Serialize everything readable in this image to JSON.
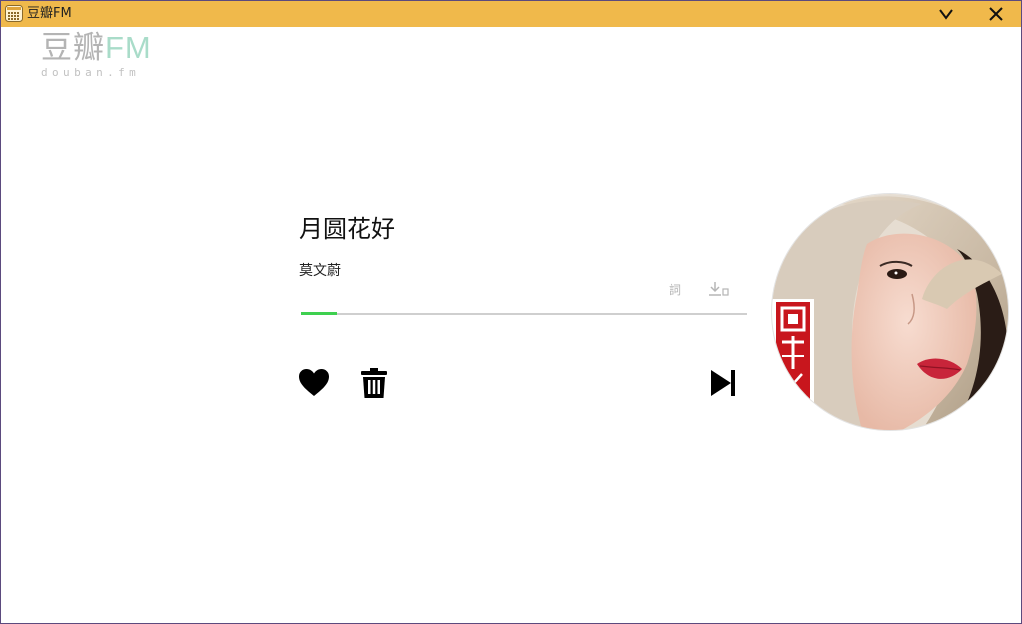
{
  "window": {
    "title": "豆瓣FM",
    "icon": "app-grid-icon",
    "minimize_icon": "chevron-down-icon",
    "close_icon": "close-icon",
    "titlebar_color": "#f0b94b"
  },
  "logo": {
    "main_cn": "豆瓣",
    "main_fm": "FM",
    "sub": "douban.fm"
  },
  "player": {
    "song_title": "月圆花好",
    "artist": "莫文蔚",
    "lyrics_label": "詞",
    "download_icon": "download-icon",
    "progress": 0.08,
    "progress_color": "#3ed04f",
    "like_icon": "heart-icon",
    "trash_icon": "trash-icon",
    "next_icon": "skip-next-icon",
    "cover_art": "album-cover-portrait"
  }
}
